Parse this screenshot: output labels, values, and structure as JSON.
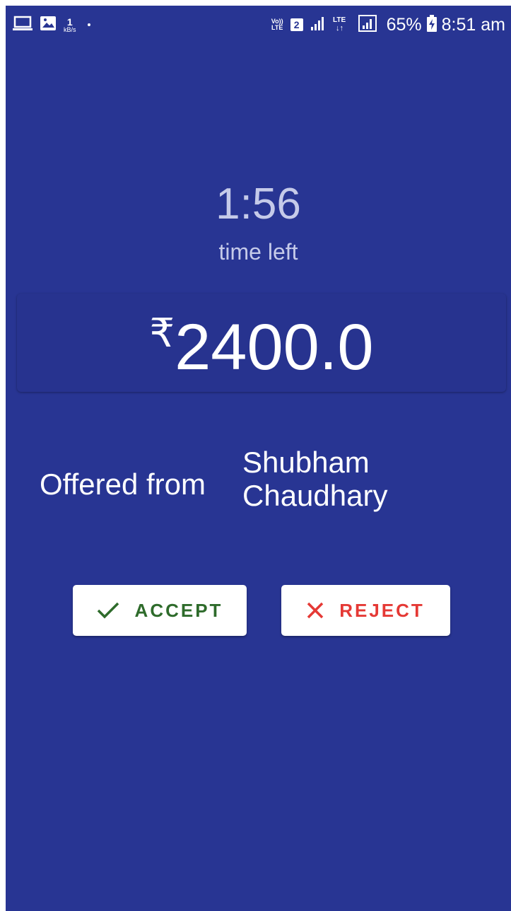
{
  "status_bar": {
    "speed_value": "1",
    "speed_unit": "kB/s",
    "volte_top": "Vo))",
    "volte_bottom": "LTE",
    "sim_slot": "2",
    "battery_percent": "65%",
    "time": "8:51 am",
    "left_icons": [
      "laptop-icon",
      "image-icon"
    ],
    "right_icons": [
      "signal-icon",
      "lte-signal-icon",
      "battery-icon"
    ]
  },
  "timer": {
    "value": "1:56",
    "label": "time left"
  },
  "offer": {
    "currency_symbol": "₹",
    "amount": "2400.0",
    "label": "Offered from",
    "name": "Shubham Chaudhary"
  },
  "actions": {
    "accept_label": "ACCEPT",
    "accept_icon": "check-icon",
    "reject_label": "REJECT",
    "reject_icon": "close-icon"
  },
  "colors": {
    "background": "#283593",
    "timer_text": "#c5cae9",
    "accept": "#2e6b2b",
    "reject": "#e53935"
  }
}
